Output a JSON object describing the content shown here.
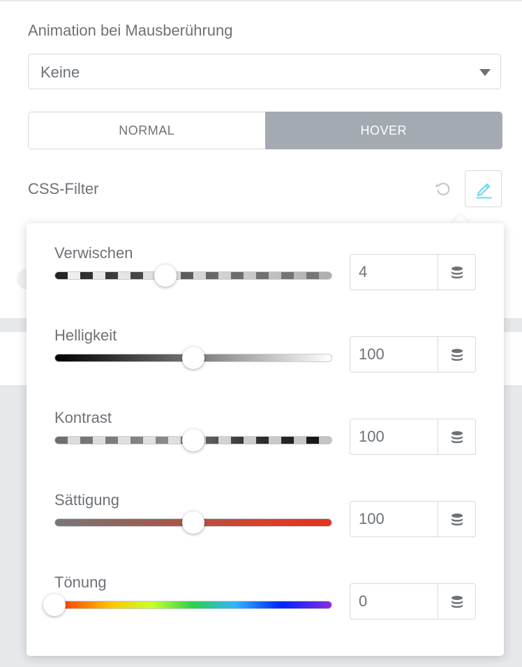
{
  "hover_animation": {
    "label": "Animation bei Mausberührung",
    "selected": "Keine"
  },
  "tabs": {
    "normal": "NORMAL",
    "hover": "HOVER",
    "active": "HOVER"
  },
  "css_filter": {
    "label": "CSS-Filter"
  },
  "filters": [
    {
      "label": "Verwischen",
      "value": "4",
      "min": 0,
      "max": 10
    },
    {
      "label": "Helligkeit",
      "value": "100",
      "min": 0,
      "max": 200
    },
    {
      "label": "Kontrast",
      "value": "100",
      "min": 0,
      "max": 200
    },
    {
      "label": "Sättigung",
      "value": "100",
      "min": 0,
      "max": 200
    },
    {
      "label": "Tönung",
      "value": "0",
      "min": 0,
      "max": 360
    }
  ],
  "icons": {
    "reset": "reset-icon",
    "edit": "pencil-icon",
    "dynamic": "database-icon",
    "dropdown": "chevron-down-icon"
  },
  "colors": {
    "accent": "#71d7f7",
    "active_tab": "#a4aab2"
  }
}
